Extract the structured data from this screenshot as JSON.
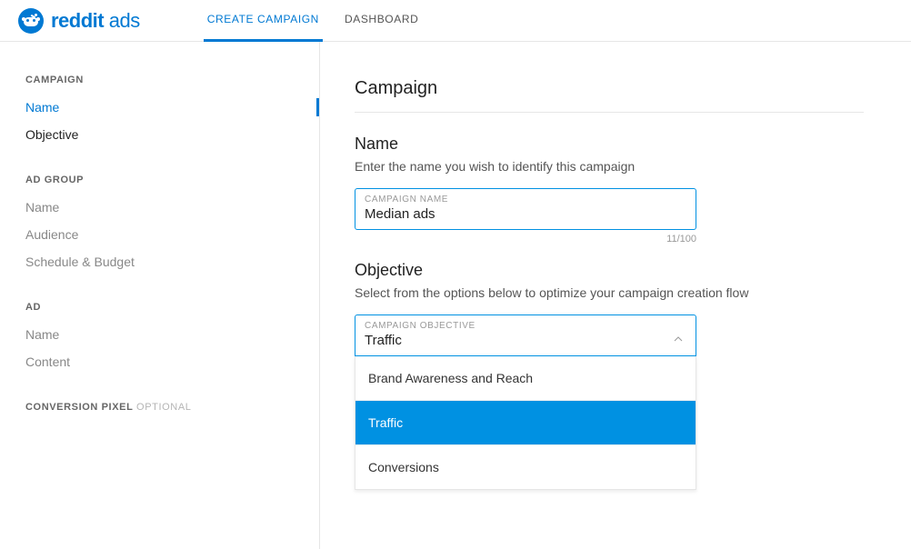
{
  "logo": {
    "brand": "reddit",
    "suffix": " ads"
  },
  "nav": {
    "create": "CREATE CAMPAIGN",
    "dashboard": "DASHBOARD"
  },
  "sidebar": {
    "campaign": {
      "title": "CAMPAIGN",
      "items": [
        "Name",
        "Objective"
      ]
    },
    "adgroup": {
      "title": "AD GROUP",
      "items": [
        "Name",
        "Audience",
        "Schedule & Budget"
      ]
    },
    "ad": {
      "title": "AD",
      "items": [
        "Name",
        "Content"
      ]
    },
    "pixel": {
      "title": "CONVERSION PIXEL",
      "optional": " OPTIONAL"
    }
  },
  "main": {
    "title": "Campaign",
    "name_section": {
      "heading": "Name",
      "desc": "Enter the name you wish to identify this campaign",
      "field_label": "CAMPAIGN NAME",
      "value": "Median ads",
      "counter": "11/100"
    },
    "objective_section": {
      "heading": "Objective",
      "desc": "Select from the options below to optimize your campaign creation flow",
      "field_label": "CAMPAIGN OBJECTIVE",
      "value": "Traffic",
      "options": [
        "Brand Awareness and Reach",
        "Traffic",
        "Conversions"
      ]
    }
  }
}
